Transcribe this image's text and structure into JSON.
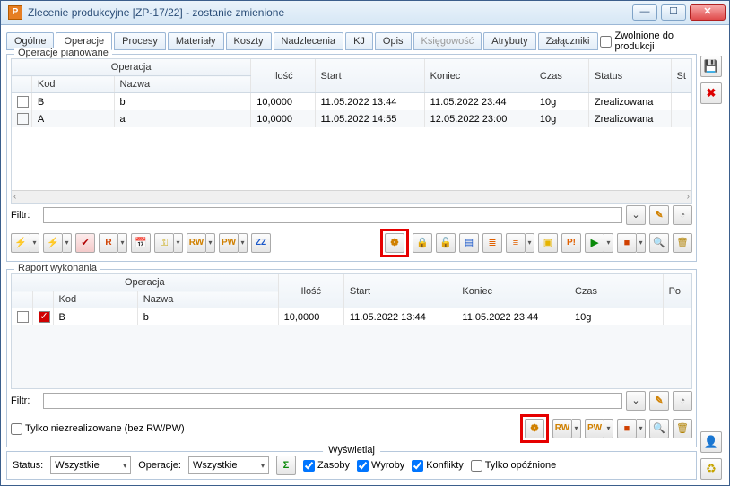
{
  "window": {
    "title": "Zlecenie produkcyjne  [ZP-17/22] - zostanie zmienione",
    "app_icon_letter": "P"
  },
  "tabs": {
    "items": [
      {
        "label": "Ogólne",
        "active": false
      },
      {
        "label": "Operacje",
        "active": true
      },
      {
        "label": "Procesy",
        "active": false
      },
      {
        "label": "Materiały",
        "active": false
      },
      {
        "label": "Koszty",
        "active": false
      },
      {
        "label": "Nadzlecenia",
        "active": false
      },
      {
        "label": "KJ",
        "active": false
      },
      {
        "label": "Opis",
        "active": false
      },
      {
        "label": "Księgowość",
        "active": false,
        "disabled": true
      },
      {
        "label": "Atrybuty",
        "active": false
      },
      {
        "label": "Załączniki",
        "active": false
      }
    ],
    "release_label": "Zwolnione do produkcji",
    "release_checked": false
  },
  "planned": {
    "legend": "Operacje planowane",
    "headers": {
      "operacja_group": "Operacja",
      "kod": "Kod",
      "nazwa": "Nazwa",
      "ilosc": "Ilość",
      "start": "Start",
      "koniec": "Koniec",
      "czas": "Czas",
      "status": "Status",
      "st_extra": "St"
    },
    "rows": [
      {
        "kod": "B",
        "nazwa": "b",
        "ilosc": "10,0000",
        "start": "11.05.2022 13:44",
        "koniec": "11.05.2022 23:44",
        "czas": "10g",
        "status": "Zrealizowana"
      },
      {
        "kod": "A",
        "nazwa": "a",
        "ilosc": "10,0000",
        "start": "11.05.2022 14:55",
        "koniec": "12.05.2022 23:00",
        "czas": "10g",
        "status": "Zrealizowana"
      }
    ],
    "filter_label": "Filtr:",
    "toolbar_text": {
      "rw": "RW",
      "pw": "PW",
      "zz": "ZZ",
      "r": "R",
      "p": "P!"
    }
  },
  "report": {
    "legend": "Raport wykonania",
    "headers": {
      "operacja_group": "Operacja",
      "kod": "Kod",
      "nazwa": "Nazwa",
      "ilosc": "Ilość",
      "start": "Start",
      "koniec": "Koniec",
      "czas": "Czas",
      "po": "Po"
    },
    "rows": [
      {
        "kod": "B",
        "nazwa": "b",
        "ilosc": "10,0000",
        "start": "11.05.2022 13:44",
        "koniec": "11.05.2022 23:44",
        "czas": "10g"
      }
    ],
    "filter_label": "Filtr:",
    "only_unrealized_label": "Tylko niezrealizowane (bez RW/PW)",
    "toolbar_text": {
      "rw": "RW",
      "pw": "PW"
    }
  },
  "display_bar": {
    "legend": "Wyświetlaj",
    "status_label": "Status:",
    "status_value": "Wszystkie",
    "operacje_label": "Operacje:",
    "operacje_value": "Wszystkie",
    "sigma": "Σ",
    "chk_zasoby": "Zasoby",
    "chk_wyroby": "Wyroby",
    "chk_konflikty": "Konflikty",
    "chk_opoznione": "Tylko opóźnione"
  },
  "icons": {
    "save": "💾",
    "close": "✖",
    "pencil": "✎",
    "funnel": "⌄",
    "bolt": "⚡",
    "bolt2": "⚡",
    "calendar": "📅",
    "key": "⚿",
    "gear": "❁",
    "lock": "🔒",
    "unlock": "🔓",
    "chart1": "▤",
    "chart2": "≣",
    "chart3": "≡",
    "layers": "▣",
    "play": "▶",
    "stop": "■",
    "search": "🔍",
    "trash": "🗑",
    "user": "👤",
    "recycle": "♻"
  }
}
